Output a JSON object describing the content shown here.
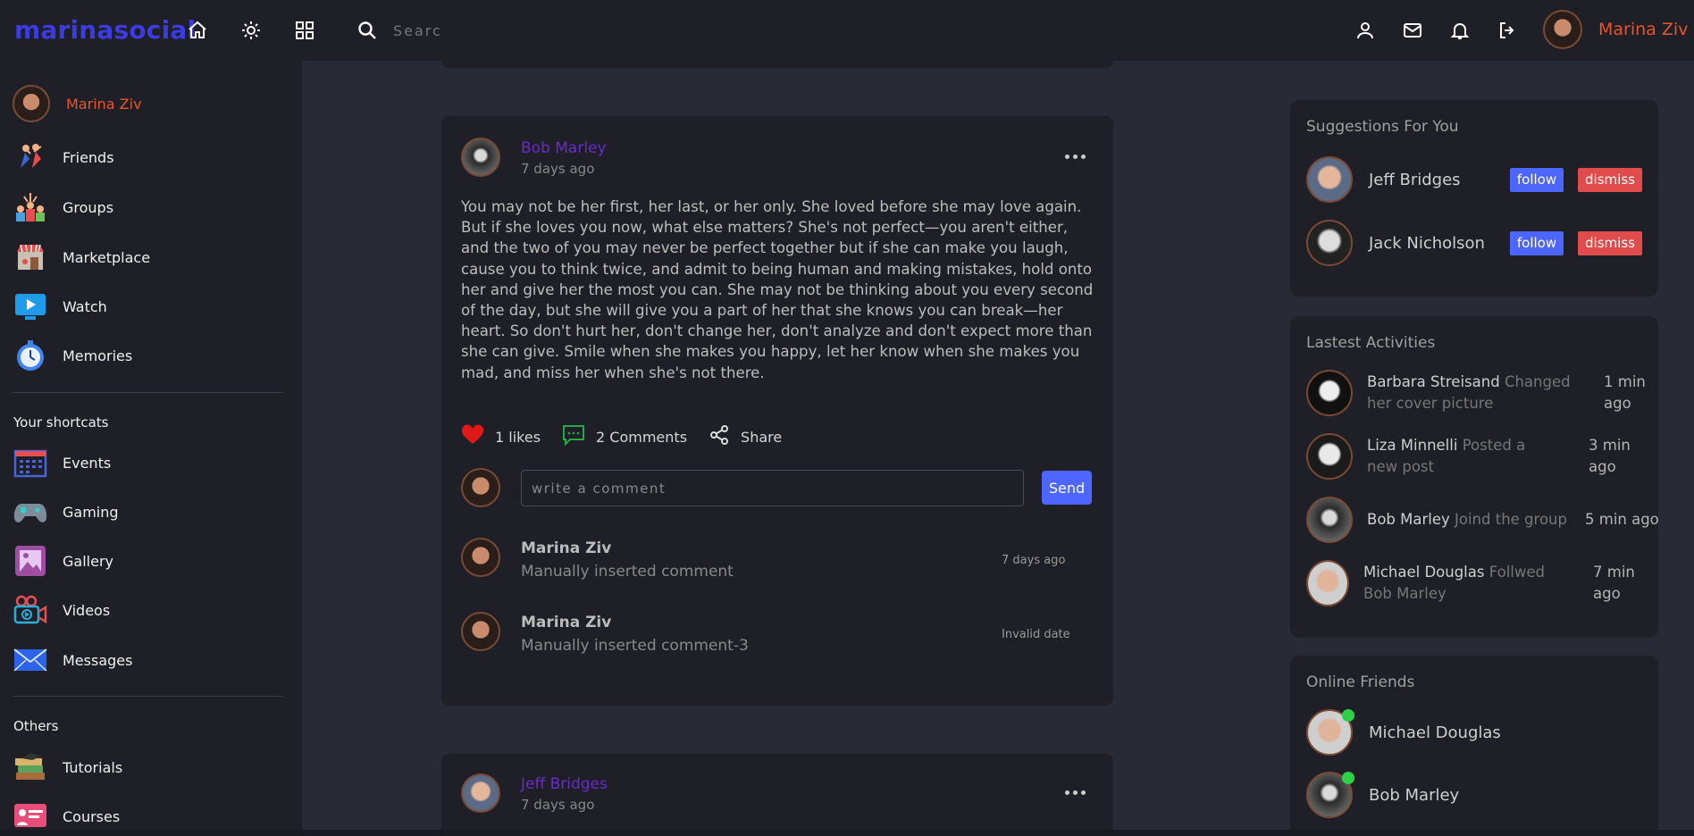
{
  "brand": {
    "logo": "marinasocial"
  },
  "topbar": {
    "search_placeholder": "Search...",
    "user_name": "Marina Ziv"
  },
  "sidebar": {
    "profile_name": "Marina Ziv",
    "main_items": [
      {
        "label": "Friends",
        "icon": "friends-icon"
      },
      {
        "label": "Groups",
        "icon": "groups-icon"
      },
      {
        "label": "Marketplace",
        "icon": "marketplace-icon"
      },
      {
        "label": "Watch",
        "icon": "watch-icon"
      },
      {
        "label": "Memories",
        "icon": "memories-icon"
      }
    ],
    "shortcuts_heading": "Your shortcats",
    "shortcuts": [
      {
        "label": "Events",
        "icon": "events-icon"
      },
      {
        "label": "Gaming",
        "icon": "gaming-icon"
      },
      {
        "label": "Gallery",
        "icon": "gallery-icon"
      },
      {
        "label": "Videos",
        "icon": "videos-icon"
      },
      {
        "label": "Messages",
        "icon": "messages-icon"
      }
    ],
    "others_heading": "Others",
    "others": [
      {
        "label": "Tutorials",
        "icon": "tutorials-icon"
      },
      {
        "label": "Courses",
        "icon": "courses-icon"
      }
    ]
  },
  "posts": [
    {
      "author": "Bob Marley",
      "time": "7 days ago",
      "body": "You may not be her first, her last, or her only. She loved before she may love again. But if she loves you now, what else matters? She's not perfect—you aren't either, and the two of you may never be perfect together but if she can make you laugh, cause you to think twice, and admit to being human and making mistakes, hold onto her and give her the most you can. She may not be thinking about you every second of the day, but she will give you a part of her that she knows you can break—her heart. So don't hurt her, don't change her, don't analyze and don't expect more than she can give. Smile when she makes you happy, let her know when she makes you mad, and miss her when she's not there.",
      "likes_label": "1 likes",
      "comments_label": "2 Comments",
      "share_label": "Share",
      "comment_placeholder": "write a comment",
      "send_label": "Send",
      "comments": [
        {
          "name": "Marina Ziv",
          "text": "Manually inserted comment",
          "time": "7 days ago"
        },
        {
          "name": "Marina Ziv",
          "text": "Manually inserted comment-3",
          "time": "Invalid date"
        }
      ]
    },
    {
      "author": "Jeff Bridges",
      "time": "7 days ago"
    }
  ],
  "suggestions": {
    "title": "Suggestions For You",
    "follow_label": "follow",
    "dismiss_label": "dismiss",
    "people": [
      {
        "name": "Jeff Bridges"
      },
      {
        "name": "Jack Nicholson"
      }
    ]
  },
  "activities": {
    "title": "Lastest Activities",
    "items": [
      {
        "name": "Barbara Streisand",
        "desc": "Changed her cover picture",
        "time": "1 min ago"
      },
      {
        "name": "Liza Minnelli",
        "desc": "Posted a new post",
        "time": "3 min ago"
      },
      {
        "name": "Bob Marley",
        "desc": "Joind the group",
        "time": "5 min ago"
      },
      {
        "name": "Michael Douglas",
        "desc": "Follwed Bob Marley",
        "time": "7 min ago"
      }
    ]
  },
  "online_friends": {
    "title": "Online Friends",
    "people": [
      {
        "name": "Michael Douglas"
      },
      {
        "name": "Bob Marley"
      }
    ]
  },
  "colors": {
    "accent_blue": "#4d66ff",
    "brand": "#3b3be0",
    "user_orange": "#e8552a",
    "dismiss_red": "#e04b4b",
    "online_green": "#2dd046",
    "author_purple": "#6a2bc7"
  }
}
